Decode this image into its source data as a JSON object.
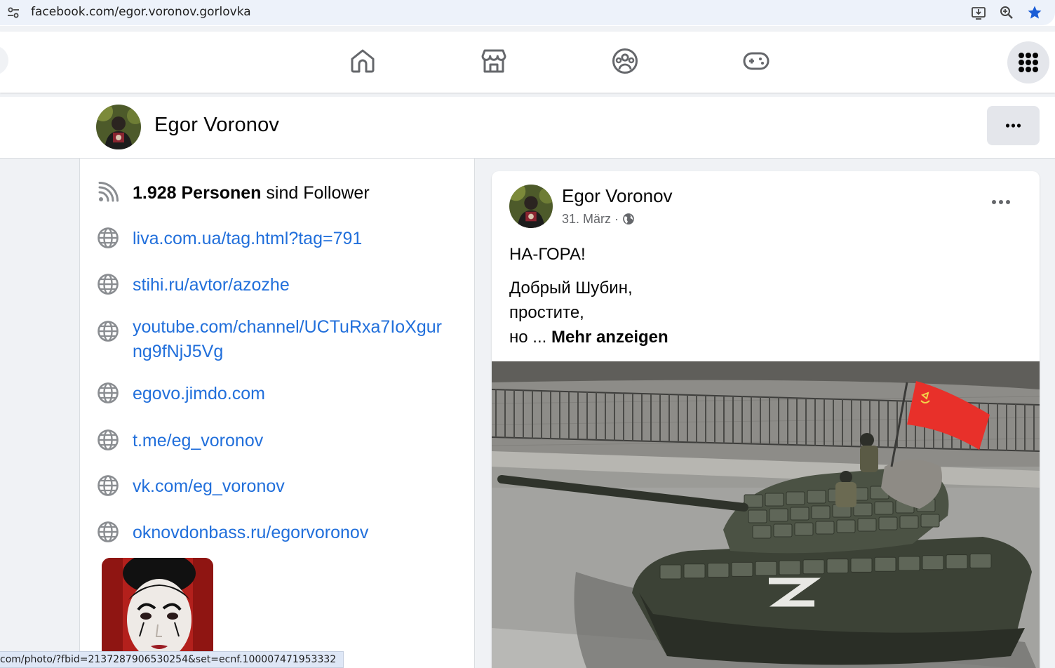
{
  "browser": {
    "url": "facebook.com/egor.voronov.gorlovka",
    "icons": [
      "tune-icon",
      "install-app-icon",
      "zoom-icon",
      "bookmark-star-icon"
    ]
  },
  "nav": {
    "icons": [
      "home-icon",
      "marketplace-icon",
      "groups-icon",
      "gaming-icon",
      "apps-grid-icon"
    ]
  },
  "profile": {
    "name": "Egor Voronov",
    "more_label": "···"
  },
  "intro": {
    "followers_count": "1.928 Personen",
    "followers_suffix": " sind Follower",
    "links": [
      "liva.com.ua/tag.html?tag=791",
      "stihi.ru/avtor/azozhe",
      "youtube.com/channel/UCTuRxa7IoXgur",
      "egovo.jimdo.com",
      "t.me/eg_voronov",
      "vk.com/eg_voronov",
      "oknovdonbass.ru/egorvoronov"
    ],
    "link_youtube_line2": "ng9fNjJ5Vg"
  },
  "post": {
    "author": "Egor Voronov",
    "date": "31. März",
    "separator": " · ",
    "line1": "НА-ГОРА!",
    "line2": "Добрый Шубин,",
    "line3": "простите,",
    "line4": "но ... ",
    "see_more": "Mehr anzeigen"
  },
  "status": {
    "hover_url": "com/photo/?fbid=2137287906530254&set=ecnf.100007471953332"
  },
  "colors": {
    "link": "#216fdb",
    "fb_bg": "#f0f2f5",
    "flag": "#e8302a"
  }
}
